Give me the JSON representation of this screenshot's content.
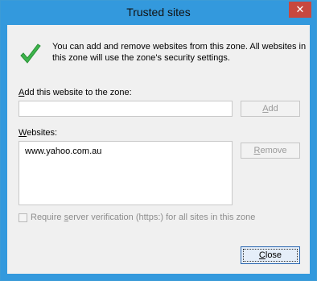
{
  "window": {
    "title": "Trusted sites",
    "close_glyph": "✕"
  },
  "intro_text": "You can add and remove websites from this zone. All websites in this zone will use the zone's security settings.",
  "add_section": {
    "label_accel": "A",
    "label_rest": "dd this website to the zone:",
    "input_value": "",
    "add_button_accel": "A",
    "add_button_rest": "dd"
  },
  "websites_section": {
    "label_accel": "W",
    "label_rest": "ebsites:",
    "items": [
      "www.yahoo.com.au"
    ],
    "remove_button_accel": "R",
    "remove_button_rest": "emove"
  },
  "require_verification": {
    "checked": false,
    "label_before": "Require ",
    "label_accel": "s",
    "label_after": "erver verification (https:) for all sites in this zone"
  },
  "close_button": {
    "accel": "C",
    "rest": "lose"
  },
  "colors": {
    "title_bar": "#3399dd",
    "close_x": "#c7483f",
    "check_green": "#3cb44b"
  }
}
